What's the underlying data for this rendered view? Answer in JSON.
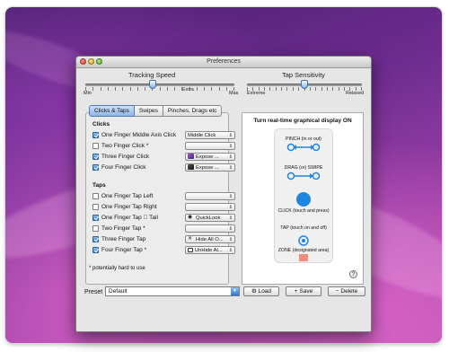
{
  "window": {
    "title": "Preferences"
  },
  "tracking": {
    "heading": "Tracking Speed",
    "min_label": "Min",
    "extra_label": "Extra",
    "max_label": "Max",
    "value_fraction": 0.45
  },
  "tap_sensitivity": {
    "heading": "Tap Sensitivity",
    "left_label": "Extreme",
    "right_label": "Relaxed",
    "value_fraction": 0.5
  },
  "tabs": [
    {
      "label": "Clicks & Taps",
      "active": true
    },
    {
      "label": "Swipes",
      "active": false
    },
    {
      "label": "Pinches, Drags etc",
      "active": false
    }
  ],
  "clicks": {
    "heading": "Clicks",
    "rows": [
      {
        "label": "One Finger Middle Axis Click",
        "checked": true,
        "select": "Middle Click",
        "icon": ""
      },
      {
        "label": "Two Finger Click *",
        "checked": false,
        "select": "",
        "icon": ""
      },
      {
        "label": "Three Finger Click",
        "checked": true,
        "select": "Expose ...",
        "icon": "expose-purple-icon"
      },
      {
        "label": "Four Finger Click",
        "checked": true,
        "select": "Expose ...",
        "icon": "expose-dark-icon"
      }
    ]
  },
  "taps": {
    "heading": "Taps",
    "rows": [
      {
        "label": "One Finger Tap Left",
        "checked": false,
        "select": "",
        "icon": ""
      },
      {
        "label": "One Finger Tap Right",
        "checked": false,
        "select": "",
        "icon": ""
      },
      {
        "label": "One Finger Tap  Tail",
        "checked": true,
        "select": "QuickLook",
        "icon": "eye-icon"
      },
      {
        "label": "Two Finger Tap *",
        "checked": false,
        "select": "",
        "icon": ""
      },
      {
        "label": "Three Finger Tap",
        "checked": true,
        "select": "Hide All O...",
        "icon": "x-icon"
      },
      {
        "label": "Four Finger Tap *",
        "checked": true,
        "select": "UnHide Al...",
        "icon": "window-icon"
      }
    ]
  },
  "footnote": "* potentially hard to use",
  "display": {
    "title": "Turn real-time graphical display ON",
    "legend": [
      {
        "label": "PINCH (in or out)",
        "icon": "pinch-icon"
      },
      {
        "label": "DRAG (or) SWIPE",
        "icon": "drag-icon"
      },
      {
        "label": "CLICK (touch and press)",
        "icon": "click-icon"
      },
      {
        "label": "TAP (touch on and off)",
        "icon": "tap-icon"
      },
      {
        "label": "ZONE (designated area)",
        "icon": "zone-icon"
      }
    ],
    "help": "?"
  },
  "preset": {
    "label": "Preset",
    "value": "Default"
  },
  "buttons": {
    "load": "Load",
    "save": "+ Save",
    "delete": "− Delete"
  },
  "colors": {
    "accent": "#2c78d2",
    "zone": "#f48a7a",
    "gesture": "#1f86e0"
  }
}
